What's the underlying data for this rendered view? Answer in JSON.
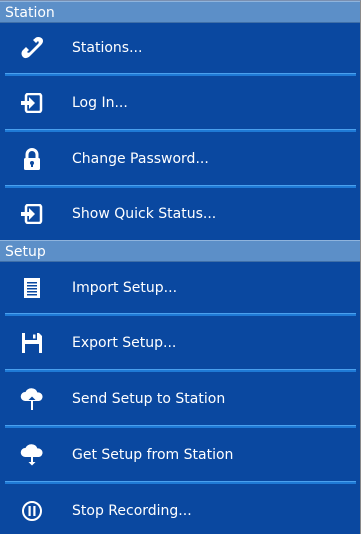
{
  "station": {
    "header": "Station",
    "items": [
      {
        "label": "Stations...",
        "icon": "phone-icon"
      },
      {
        "label": "Log In...",
        "icon": "login-icon"
      },
      {
        "label": "Change Password...",
        "icon": "lock-icon"
      },
      {
        "label": "Show Quick Status...",
        "icon": "login-icon"
      }
    ]
  },
  "setup": {
    "header": "Setup",
    "items": [
      {
        "label": "Import Setup...",
        "icon": "document-icon"
      },
      {
        "label": "Export Setup...",
        "icon": "floppy-disk-icon"
      },
      {
        "label": "Send Setup to Station",
        "icon": "cloud-upload-icon"
      },
      {
        "label": "Get Setup from Station",
        "icon": "cloud-download-icon"
      },
      {
        "label": "Stop Recording...",
        "icon": "pause-circle-icon"
      }
    ]
  },
  "colors": {
    "panel_bg": "#0a48a0",
    "header_bg": "#5c8fc8",
    "divider": "#1f7ad6",
    "text": "#ffffff"
  }
}
